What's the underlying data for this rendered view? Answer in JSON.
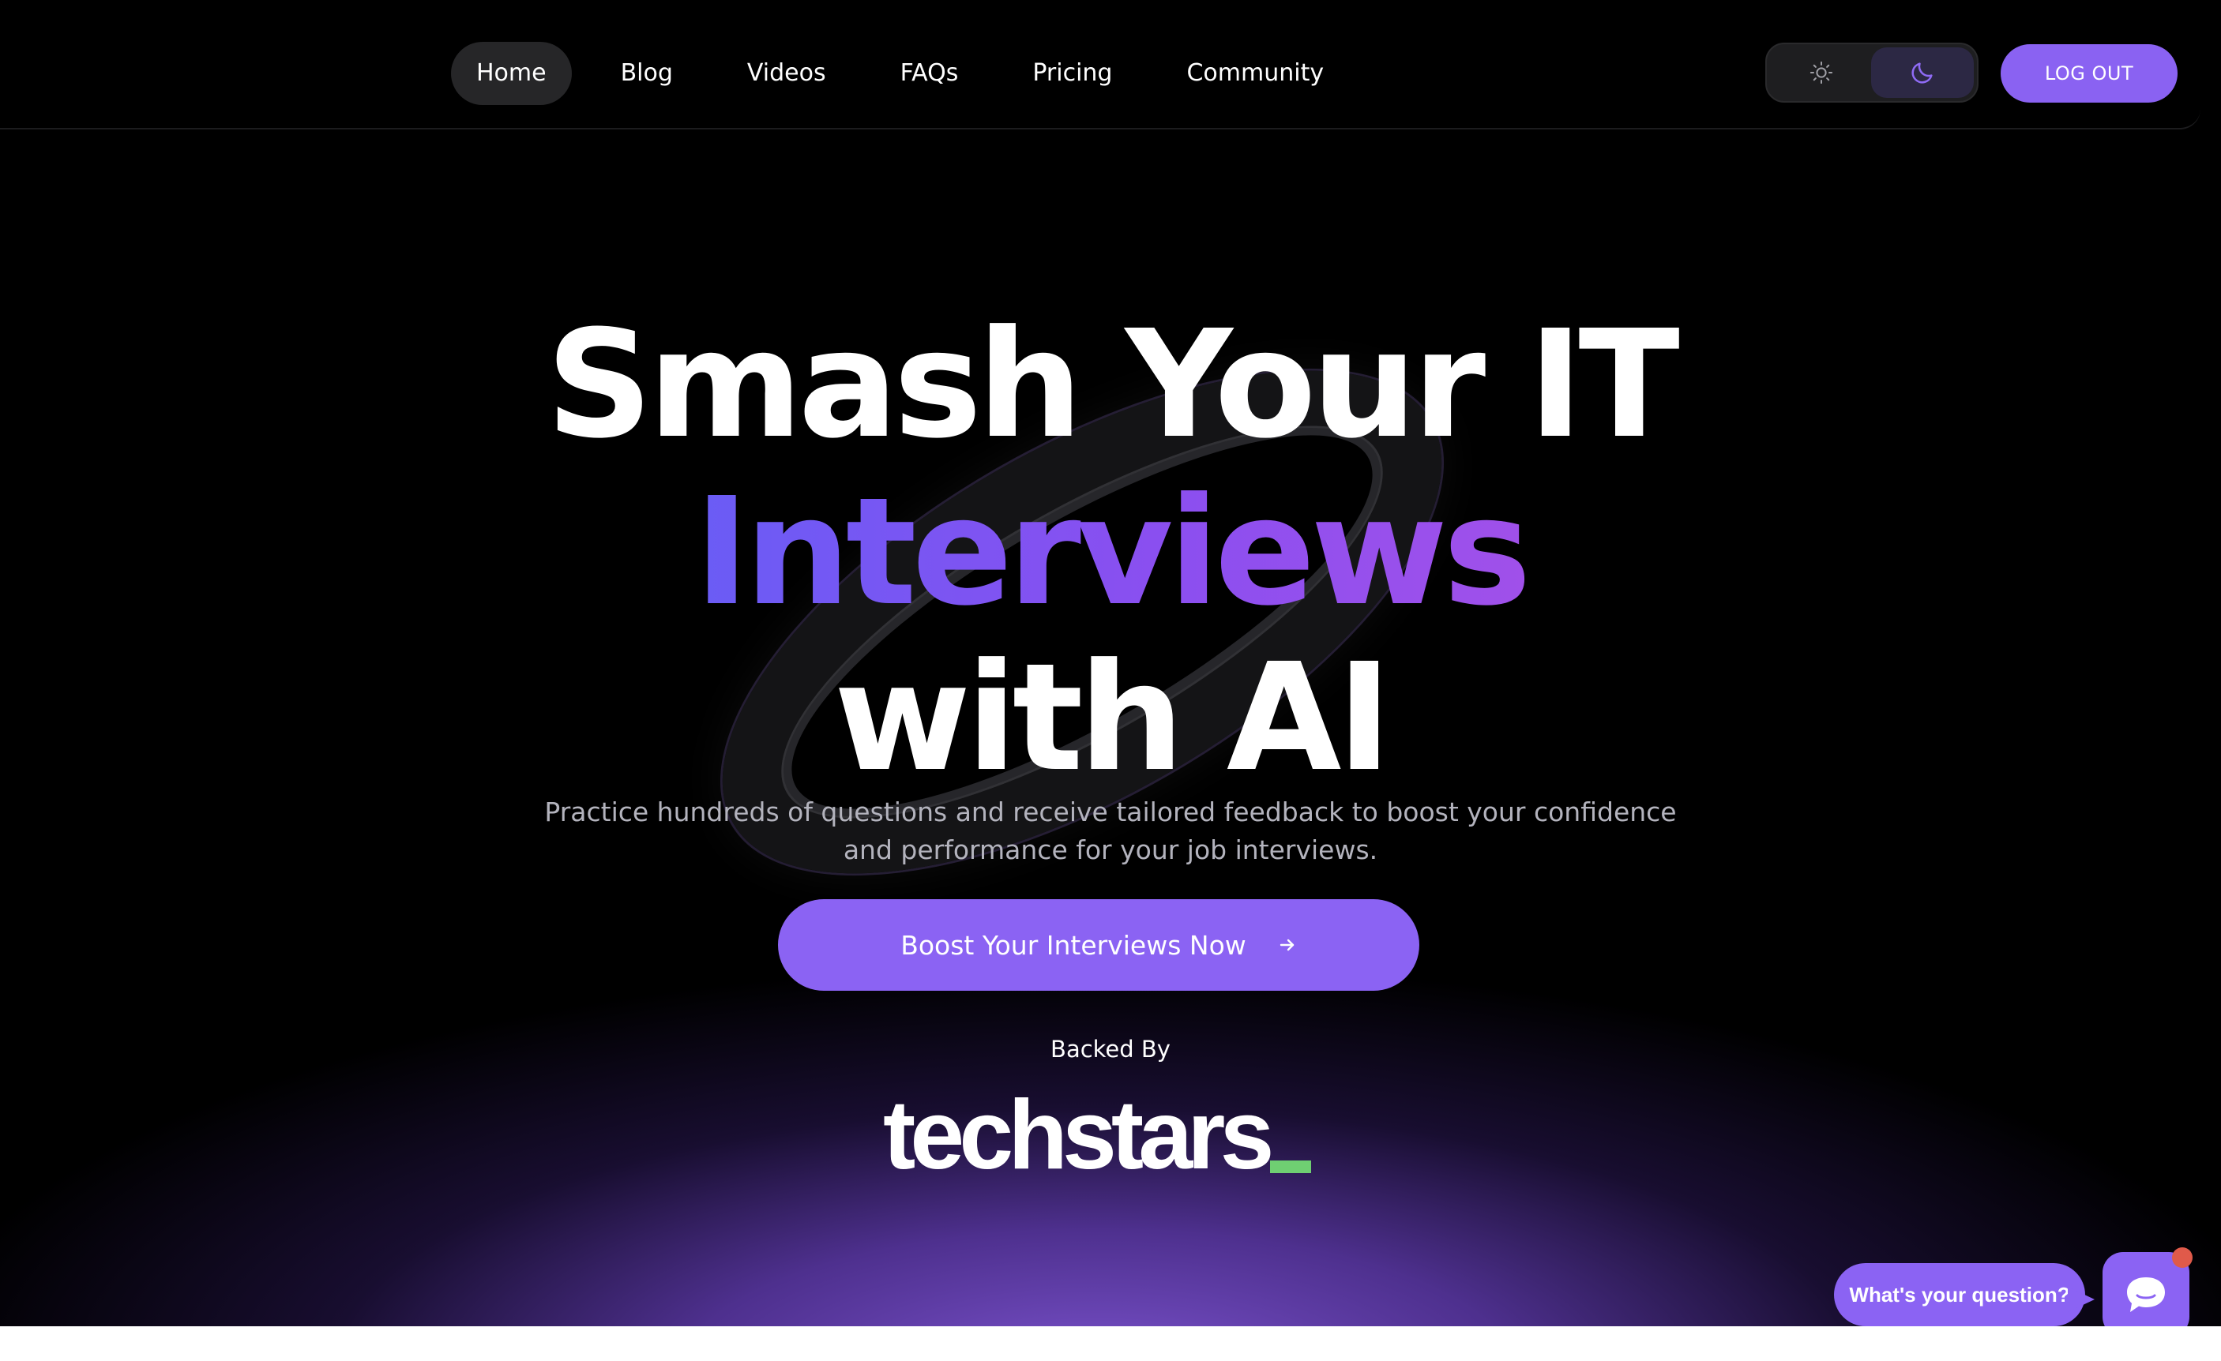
{
  "nav": {
    "links": [
      {
        "label": "Home",
        "active": true
      },
      {
        "label": "Blog",
        "active": false
      },
      {
        "label": "Videos",
        "active": false
      },
      {
        "label": "FAQs",
        "active": false
      },
      {
        "label": "Pricing",
        "active": false
      },
      {
        "label": "Community",
        "active": false
      }
    ],
    "theme_toggle": {
      "light_icon": "sun-icon",
      "dark_icon": "moon-icon",
      "selected": "dark"
    },
    "logout_label": "LOG OUT"
  },
  "hero": {
    "line1": "Smash Your IT",
    "line2": "Interviews",
    "line3": "with AI",
    "subtitle_line1": "Practice hundreds of questions and receive tailored feedback to boost your confidence",
    "subtitle_line2": "and performance for your job interviews.",
    "cta_label": "Boost Your Interviews Now",
    "cta_icon": "arrow-right-icon",
    "backed_by": "Backed By",
    "backer_logo_text": "techstars"
  },
  "chat": {
    "prompt": "What's your question?",
    "launcher_icon": "chat-bubble-icon",
    "has_notification": true
  },
  "colors": {
    "background": "#000000",
    "accent": "#8b63f3",
    "gradient_start": "#6a5cf5",
    "gradient_end": "#a050ea",
    "glow": "#8056d6",
    "techstars_green": "#6fcf72",
    "notification_dot": "#e05a4a"
  }
}
